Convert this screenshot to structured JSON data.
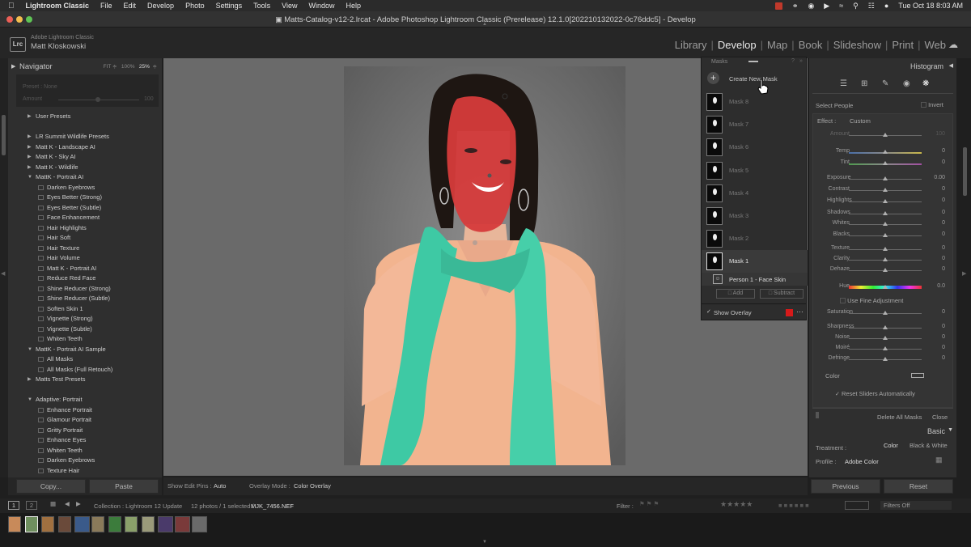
{
  "menubar": {
    "apple_icon": "apple-logo",
    "app_name": "Lightroom Classic",
    "items": [
      "File",
      "Edit",
      "Develop",
      "Photo",
      "Settings",
      "Tools",
      "View",
      "Window",
      "Help"
    ],
    "date_time": "Tue Oct 18  8:03 AM"
  },
  "window": {
    "title": "Matts-Catalog-v12-2.lrcat - Adobe Photoshop Lightroom Classic (Prerelease) 12.1.0[202210132022-0c76ddc5] - Develop"
  },
  "identity": {
    "logo_text": "Lrc",
    "product": "Adobe Lightroom Classic",
    "user": "Matt Kloskowski"
  },
  "modules": [
    "Library",
    "Develop",
    "Map",
    "Book",
    "Slideshow",
    "Print",
    "Web"
  ],
  "active_module": "Develop",
  "navigator": {
    "title": "Navigator",
    "zoom_fit": "FIT ≑",
    "zoom_100": "100%",
    "zoom_25": "25%",
    "preset_label": "Preset : None",
    "amount_label": "Amount",
    "amount_value": "100"
  },
  "presets": {
    "rows": [
      {
        "kind": "folder",
        "open": false,
        "label": "User Presets"
      },
      {
        "kind": "spacer",
        "label": ""
      },
      {
        "kind": "folder",
        "open": false,
        "label": "LR Summit Wildlife Presets"
      },
      {
        "kind": "folder",
        "open": false,
        "label": "Matt K - Landscape AI"
      },
      {
        "kind": "folder",
        "open": false,
        "label": "Matt K - Sky AI"
      },
      {
        "kind": "folder",
        "open": false,
        "label": "Matt K - Wildlife"
      },
      {
        "kind": "folder",
        "open": true,
        "label": "MattK - Portrait AI"
      },
      {
        "kind": "preset",
        "label": "Darken Eyebrows"
      },
      {
        "kind": "preset",
        "label": "Eyes Better (Strong)"
      },
      {
        "kind": "preset",
        "label": "Eyes Better (Subtle)"
      },
      {
        "kind": "preset",
        "label": "Face Enhancement"
      },
      {
        "kind": "preset",
        "label": "Hair Highlights"
      },
      {
        "kind": "preset",
        "label": "Hair Soft"
      },
      {
        "kind": "preset",
        "label": "Hair Texture"
      },
      {
        "kind": "preset",
        "label": "Hair Volume"
      },
      {
        "kind": "preset",
        "label": "Matt K - Portrait AI"
      },
      {
        "kind": "preset",
        "label": "Reduce Red Face"
      },
      {
        "kind": "preset",
        "label": "Shine Reducer (Strong)"
      },
      {
        "kind": "preset",
        "label": "Shine Reducer (Subtle)"
      },
      {
        "kind": "preset",
        "label": "Soften Skin 1"
      },
      {
        "kind": "preset",
        "label": "Vignette (Strong)"
      },
      {
        "kind": "preset",
        "label": "Vignette (Subtle)"
      },
      {
        "kind": "preset",
        "label": "Whiten Teeth"
      },
      {
        "kind": "folder",
        "open": true,
        "label": "MattK - Portrait AI Sample"
      },
      {
        "kind": "preset",
        "label": "All Masks"
      },
      {
        "kind": "preset",
        "label": "All Masks (Full Retouch)"
      },
      {
        "kind": "folder",
        "open": false,
        "label": "Matts Test Presets"
      },
      {
        "kind": "spacer",
        "label": ""
      },
      {
        "kind": "folder",
        "open": true,
        "label": "Adaptive: Portrait"
      },
      {
        "kind": "preset",
        "label": "Enhance Portrait"
      },
      {
        "kind": "preset",
        "label": "Glamour Portrait"
      },
      {
        "kind": "preset",
        "label": "Gritty Portrait"
      },
      {
        "kind": "preset",
        "label": "Enhance Eyes"
      },
      {
        "kind": "preset",
        "label": "Whiten Teeth"
      },
      {
        "kind": "preset",
        "label": "Darken Eyebrows"
      },
      {
        "kind": "preset",
        "label": "Texture Hair"
      }
    ]
  },
  "left_buttons": {
    "copy": "Copy...",
    "paste": "Paste"
  },
  "toolbar": {
    "edit_pins_label": "Show Edit Pins :",
    "edit_pins_value": "Auto",
    "overlay_label": "Overlay Mode :",
    "overlay_value": "Color Overlay"
  },
  "masks_panel": {
    "title": "Masks",
    "create_label": "Create New Mask",
    "masks": [
      "Mask 8",
      "Mask 7",
      "Mask 6",
      "Mask 5",
      "Mask 4",
      "Mask 3",
      "Mask 2",
      "Mask 1"
    ],
    "component": "Person 1 - Face Skin",
    "add_label": "Add",
    "subtract_label": "Subtract",
    "show_overlay_label": "Show Overlay",
    "overlay_color": "#d61a1a"
  },
  "right_panel": {
    "histogram_title": "Histogram",
    "select_people": "Select People",
    "invert": "Invert",
    "effect_label": "Effect :",
    "effect_value": "Custom",
    "sliders": [
      {
        "label": "Amount",
        "value": "100",
        "pos": 0.5,
        "track": "gray"
      },
      {
        "label": "Temp",
        "value": "0",
        "pos": 0.5,
        "track": "temp"
      },
      {
        "label": "Tint",
        "value": "0",
        "pos": 0.5,
        "track": "tint"
      },
      {
        "label": "Exposure",
        "value": "0.00",
        "pos": 0.5,
        "track": "gray"
      },
      {
        "label": "Contrast",
        "value": "0",
        "pos": 0.5,
        "track": "gray"
      },
      {
        "label": "Highlights",
        "value": "0",
        "pos": 0.5,
        "track": "gray"
      },
      {
        "label": "Shadows",
        "value": "0",
        "pos": 0.5,
        "track": "gray"
      },
      {
        "label": "Whites",
        "value": "0",
        "pos": 0.5,
        "track": "gray"
      },
      {
        "label": "Blacks",
        "value": "0",
        "pos": 0.5,
        "track": "gray"
      },
      {
        "label": "Texture",
        "value": "0",
        "pos": 0.5,
        "track": "gray"
      },
      {
        "label": "Clarity",
        "value": "0",
        "pos": 0.5,
        "track": "gray"
      },
      {
        "label": "Dehaze",
        "value": "0",
        "pos": 0.5,
        "track": "gray"
      },
      {
        "label": "Hue",
        "value": "0.0",
        "pos": 0.5,
        "track": "hue"
      },
      {
        "label": "Saturation",
        "value": "0",
        "pos": 0.5,
        "track": "gray"
      },
      {
        "label": "Sharpness",
        "value": "0",
        "pos": 0.5,
        "track": "gray"
      },
      {
        "label": "Noise",
        "value": "0",
        "pos": 0.5,
        "track": "gray"
      },
      {
        "label": "Moiré",
        "value": "0",
        "pos": 0.5,
        "track": "gray"
      },
      {
        "label": "Defringe",
        "value": "0",
        "pos": 0.5,
        "track": "gray"
      }
    ],
    "use_fine": "Use Fine Adjustment",
    "color_label": "Color",
    "reset_auto": "Reset Sliders Automatically",
    "delete_all": "Delete All Masks",
    "close": "Close",
    "basic_title": "Basic",
    "treatment_label": "Treatment :",
    "treatment_color": "Color",
    "treatment_bw": "Black & White",
    "profile_label": "Profile :",
    "profile_value": "Adobe Color",
    "previous": "Previous",
    "reset": "Reset"
  },
  "filmstrip_bar": {
    "view1": "1",
    "view2": "2",
    "collection": "Collection : Lightroom 12 Update",
    "count": "12 photos / 1 selected /",
    "filename": "MJK_7456.NEF",
    "filter_label": "Filter :",
    "filters_off": "Filters Off"
  }
}
